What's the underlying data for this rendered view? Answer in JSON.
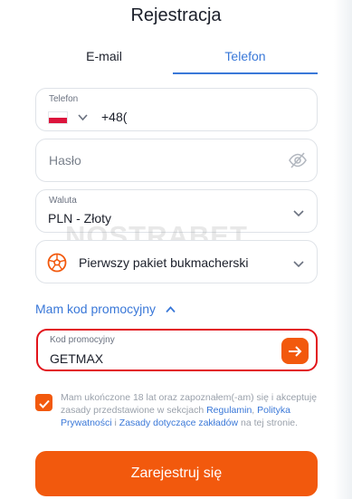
{
  "page": {
    "title": "Rejestracja"
  },
  "tabs": [
    {
      "label": "E-mail",
      "active": false
    },
    {
      "label": "Telefon",
      "active": true
    }
  ],
  "phone": {
    "label": "Telefon",
    "country": "poland-flag",
    "prefix": "+48("
  },
  "password": {
    "placeholder": "Hasło",
    "icon": "eye-off-icon"
  },
  "currency": {
    "label": "Waluta",
    "value": "PLN - Złoty"
  },
  "bonus": {
    "value": "Pierwszy pakiet bukmacherski",
    "icon": "soccer-ball-icon"
  },
  "promo": {
    "toggle_label": "Mam kod promocyjny",
    "label": "Kod promocyjny",
    "value": "GETMAX"
  },
  "consent": {
    "checked": true,
    "text_1": "Mam ukończone 18 lat oraz zapoznałem(-am) się i akceptuję zasady przedstawione w sekcjach",
    "link_regulamin": "Regulamin",
    "sep_1": ", ",
    "link_privacy": "Polityka Prywatności",
    "sep_2": " i ",
    "link_rules": "Zasady dotyczące zakładów",
    "text_2": " na tej stronie."
  },
  "submit": {
    "label": "Zarejestruj się"
  },
  "watermark": "NOSTRABET",
  "colors": {
    "accent": "#f2590d",
    "link": "#3a78d8",
    "promo_border": "#e2141b"
  }
}
